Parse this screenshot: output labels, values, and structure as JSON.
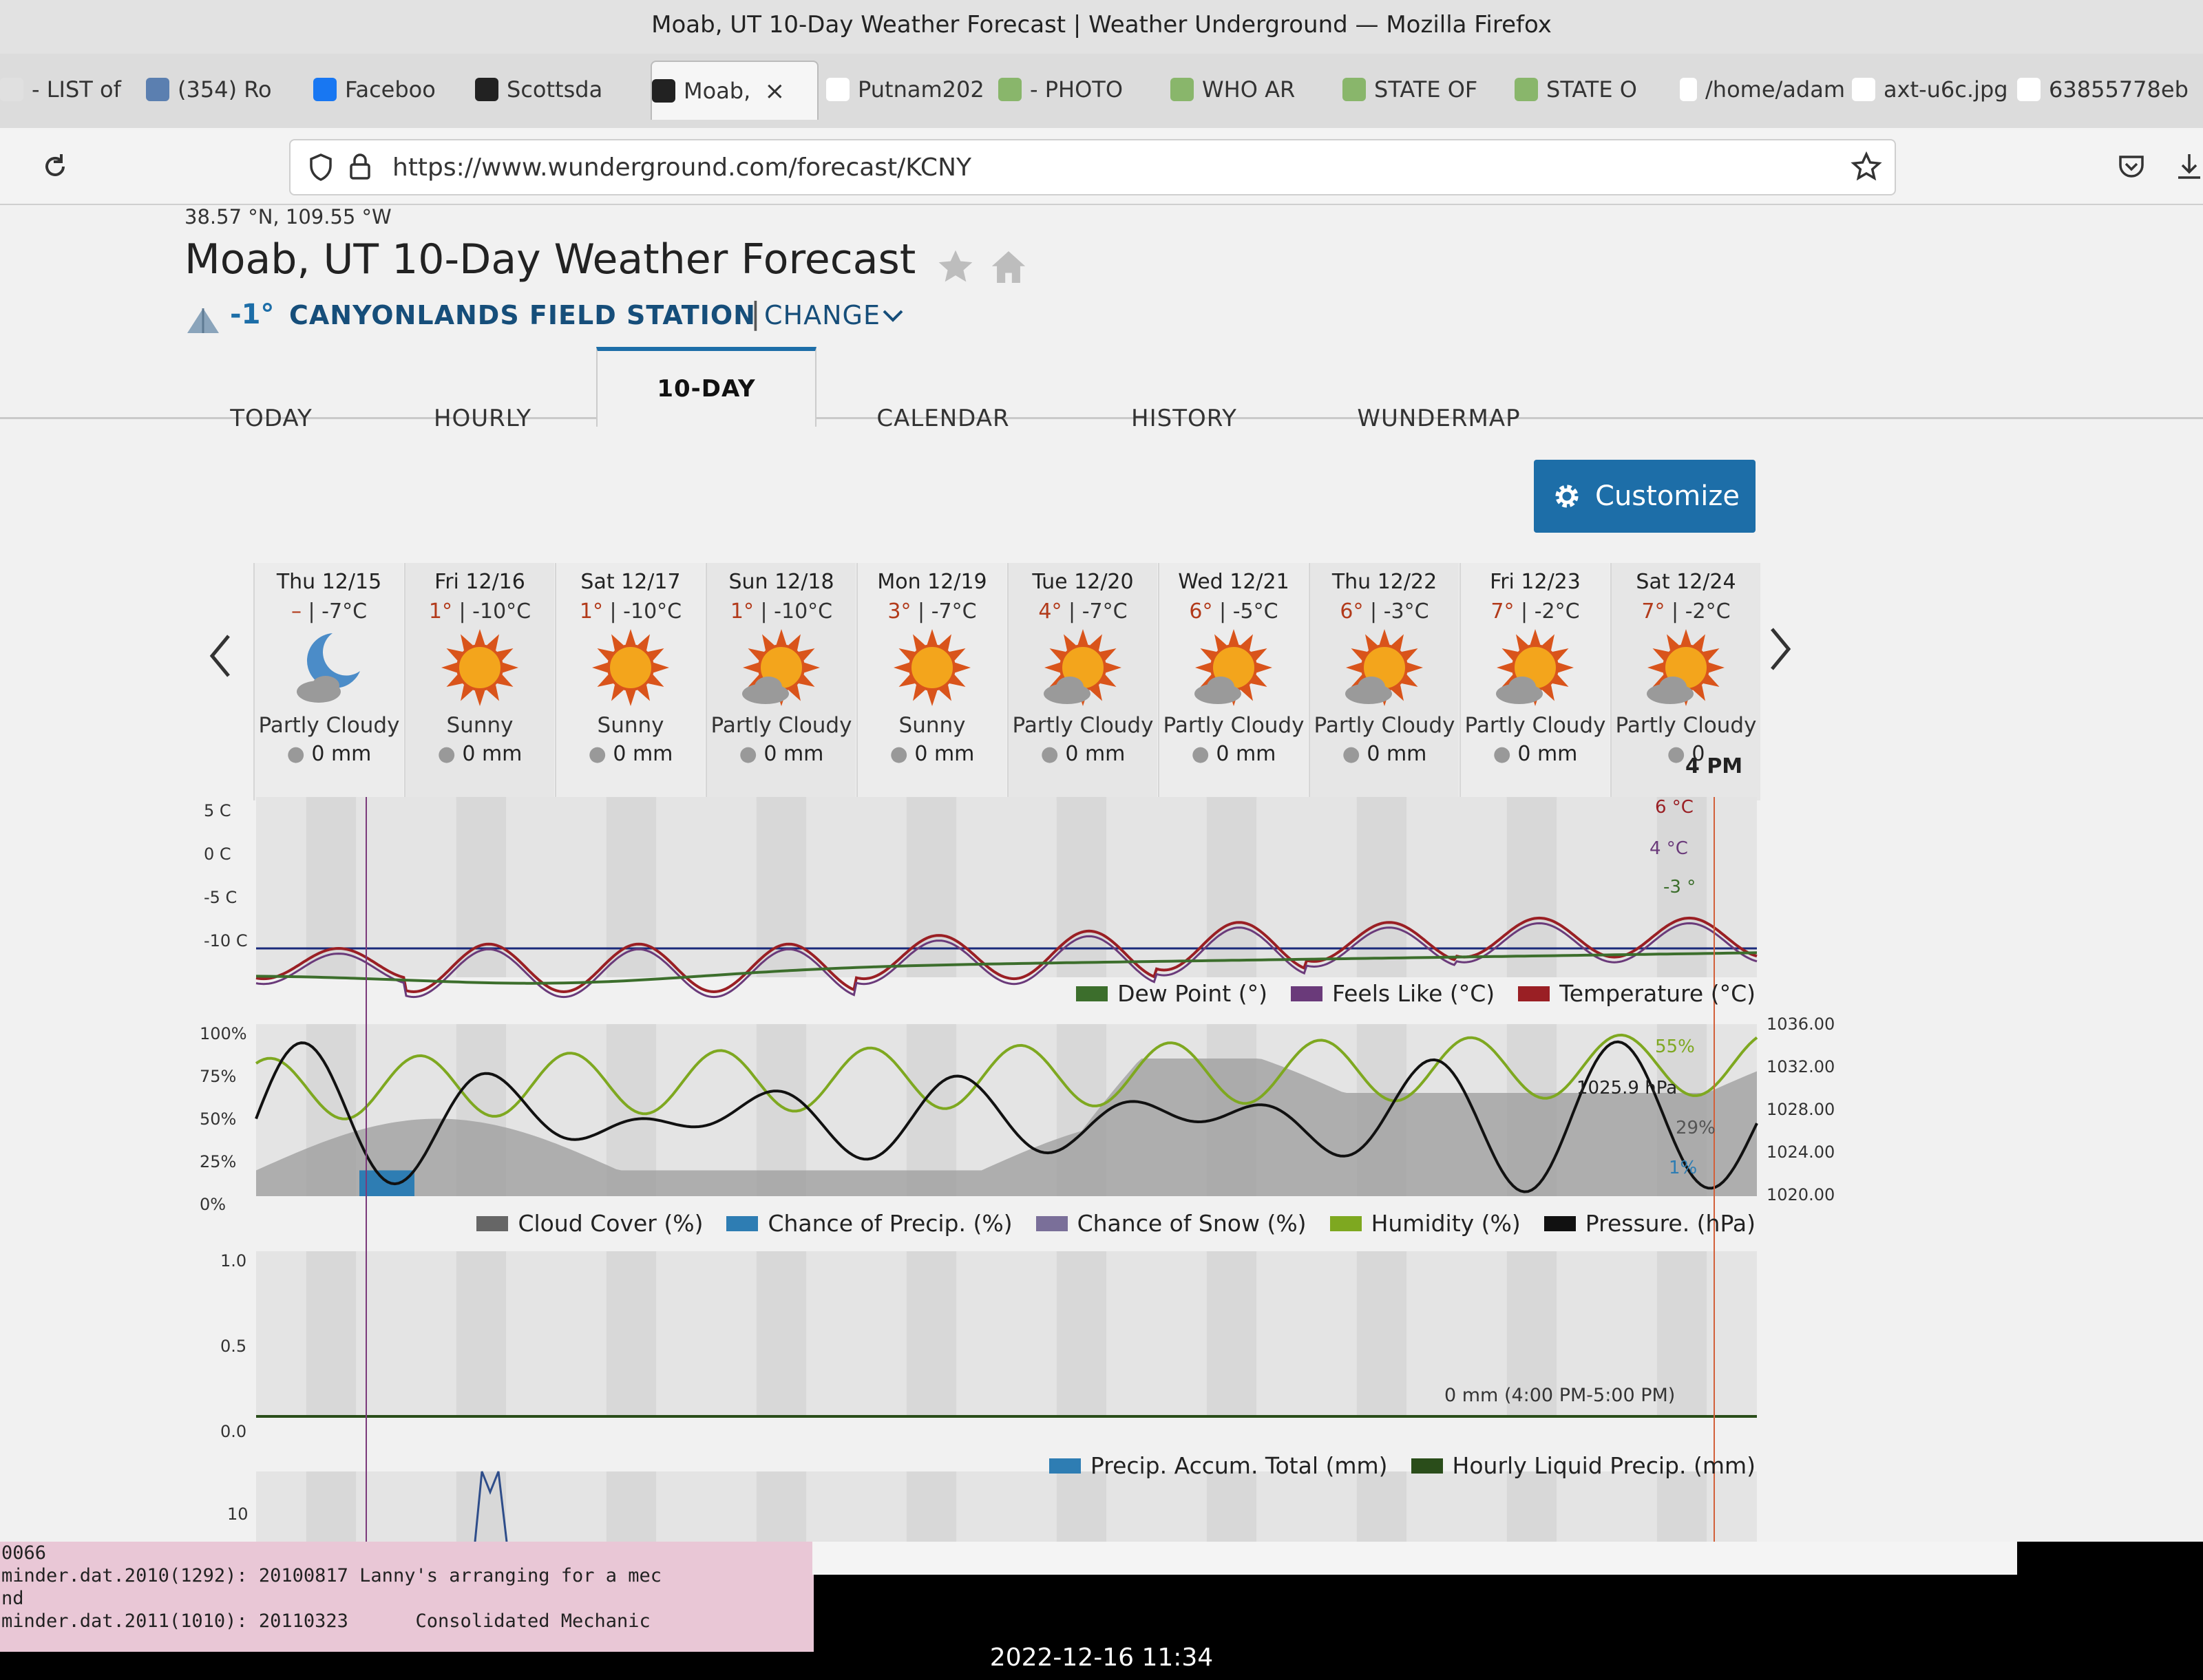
{
  "window_title": "Moab, UT 10-Day Weather Forecast | Weather Underground — Mozilla Firefox",
  "browser_tabs": [
    {
      "label": "- LIST of"
    },
    {
      "label": "(354) Ro"
    },
    {
      "label": "Faceboo"
    },
    {
      "label": "Scottsda"
    },
    {
      "label": "Moab,",
      "active": true
    },
    {
      "label": "Putnam202"
    },
    {
      "label": "- PHOTO"
    },
    {
      "label": "WHO AR"
    },
    {
      "label": "STATE OF"
    },
    {
      "label": "STATE O"
    },
    {
      "label": "/home/adam"
    },
    {
      "label": "axt-u6c.jpg"
    },
    {
      "label": "63855778eb"
    }
  ],
  "url": "https://www.wunderground.com/forecast/KCNY",
  "coords": "38.57 °N, 109.55 °W",
  "page_title": "Moab, UT 10-Day Weather Forecast",
  "station": {
    "temp": "-1°",
    "name": "CANYONLANDS FIELD STATION",
    "change": "CHANGE"
  },
  "nav_tabs": [
    {
      "label": "TODAY"
    },
    {
      "label": "HOURLY"
    },
    {
      "label": "10-DAY",
      "active": true
    },
    {
      "label": "CALENDAR"
    },
    {
      "label": "HISTORY"
    },
    {
      "label": "WUNDERMAP"
    }
  ],
  "customize_label": "Customize",
  "days": [
    {
      "date": "Thu 12/15",
      "hi": "–",
      "lo": "-7°C",
      "cond": "Partly Cloudy",
      "precip": "0 mm",
      "icon": "moon-cloud"
    },
    {
      "date": "Fri 12/16",
      "hi": "1°",
      "lo": "-10°C",
      "cond": "Sunny",
      "precip": "0 mm",
      "icon": "sun"
    },
    {
      "date": "Sat 12/17",
      "hi": "1°",
      "lo": "-10°C",
      "cond": "Sunny",
      "precip": "0 mm",
      "icon": "sun"
    },
    {
      "date": "Sun 12/18",
      "hi": "1°",
      "lo": "-10°C",
      "cond": "Partly Cloudy",
      "precip": "0 mm",
      "icon": "sun-cloud"
    },
    {
      "date": "Mon 12/19",
      "hi": "3°",
      "lo": "-7°C",
      "cond": "Sunny",
      "precip": "0 mm",
      "icon": "sun"
    },
    {
      "date": "Tue 12/20",
      "hi": "4°",
      "lo": "-7°C",
      "cond": "Partly Cloudy",
      "precip": "0 mm",
      "icon": "sun-cloud"
    },
    {
      "date": "Wed 12/21",
      "hi": "6°",
      "lo": "-5°C",
      "cond": "Partly Cloudy",
      "precip": "0 mm",
      "icon": "sun-cloud"
    },
    {
      "date": "Thu 12/22",
      "hi": "6°",
      "lo": "-3°C",
      "cond": "Partly Cloudy",
      "precip": "0 mm",
      "icon": "sun-cloud"
    },
    {
      "date": "Fri 12/23",
      "hi": "7°",
      "lo": "-2°C",
      "cond": "Partly Cloudy",
      "precip": "0 mm",
      "icon": "sun-cloud"
    },
    {
      "date": "Sat 12/24",
      "hi": "7°",
      "lo": "-2°C",
      "cond": "Partly Cloudy",
      "precip": "0",
      "icon": "sun-cloud"
    }
  ],
  "hover_time": "4 PM",
  "temp_chart": {
    "y_ticks": [
      "5 C",
      "0 C",
      "-5 C",
      "-10 C"
    ],
    "annotations": [
      "6 °C",
      "4 °C",
      "-3 °"
    ],
    "legend": [
      {
        "name": "Dew Point (°)",
        "color": "#3c6e2c"
      },
      {
        "name": "Feels Like (°C)",
        "color": "#6a3a7a"
      },
      {
        "name": "Temperature (°C)",
        "color": "#9a1f24"
      }
    ]
  },
  "pct_chart": {
    "y_ticks_left": [
      "100%",
      "75%",
      "50%",
      "25%",
      "0%"
    ],
    "y_ticks_right": [
      "1036.00",
      "1032.00",
      "1028.00",
      "1024.00",
      "1020.00"
    ],
    "annotations": [
      "55%",
      "1025.9 hPa",
      "29%",
      "1%"
    ],
    "legend": [
      {
        "name": "Cloud Cover (%)",
        "color": "#666666"
      },
      {
        "name": "Chance of Precip. (%)",
        "color": "#2e7db3"
      },
      {
        "name": "Chance of Snow (%)",
        "color": "#7a6f99"
      },
      {
        "name": "Humidity (%)",
        "color": "#7ea820"
      },
      {
        "name": "Pressure. (hPa)",
        "color": "#111111"
      }
    ]
  },
  "precip_chart": {
    "y_ticks": [
      "1.0",
      "0.5",
      "0.0"
    ],
    "tooltip": "0 mm (4:00 PM-5:00 PM)",
    "legend": [
      {
        "name": "Precip. Accum. Total (mm)",
        "color": "#2e7db3"
      },
      {
        "name": "Hourly Liquid Precip. (mm)",
        "color": "#2a4d1a"
      }
    ]
  },
  "snow_chart": {
    "y_ticks": [
      "10"
    ]
  },
  "terminal_lines": [
    "0066",
    "minder.dat.2010(1292): 20100817 Lanny's arranging for a mec",
    "nd",
    "minder.dat.2011(1010): 20110323      Consolidated Mechanic"
  ],
  "photo_timestamp": "2022-12-16 11:34"
}
